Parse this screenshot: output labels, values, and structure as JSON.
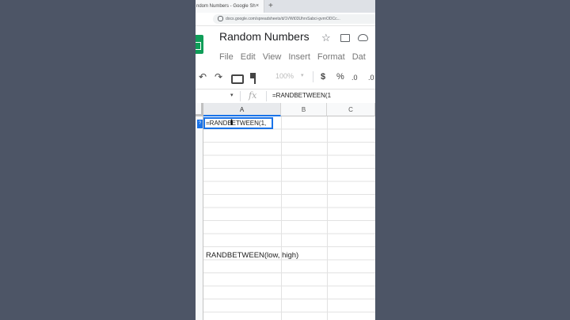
{
  "browser": {
    "tab_title": "ndom Numbers - Google Sh",
    "tab_close": "×",
    "new_tab": "+",
    "url": "docs.google.com/spreadsheets/d/1VWt03UhrvSabci-gvrnODCc..."
  },
  "sheets": {
    "title": "Random Numbers",
    "menu": [
      "File",
      "Edit",
      "View",
      "Insert",
      "Format",
      "Dat"
    ],
    "zoom": "100%",
    "toolbar": {
      "undo": "↶",
      "redo": "↷",
      "currency": "$",
      "percent": "%",
      "decrease_decimals": ".0",
      "increase_decimals": ".0"
    },
    "formula_bar": {
      "fx": "fx",
      "value": "=RANDBETWEEN(1"
    },
    "columns": [
      "A",
      "B",
      "C"
    ],
    "row_marker": "?",
    "active_cell_text": "=RANDBETWEEN(1,",
    "caption": "RANDBETWEEN(low, high)"
  },
  "icons": [
    "star-icon",
    "folder-icon",
    "cloud-icon",
    "undo-icon",
    "redo-icon",
    "print-icon",
    "paint-format-icon",
    "text-cursor-icon"
  ],
  "colors": {
    "accent": "#1a73e8",
    "sheets_green": "#0f9d58",
    "backdrop": "#4d5566"
  }
}
